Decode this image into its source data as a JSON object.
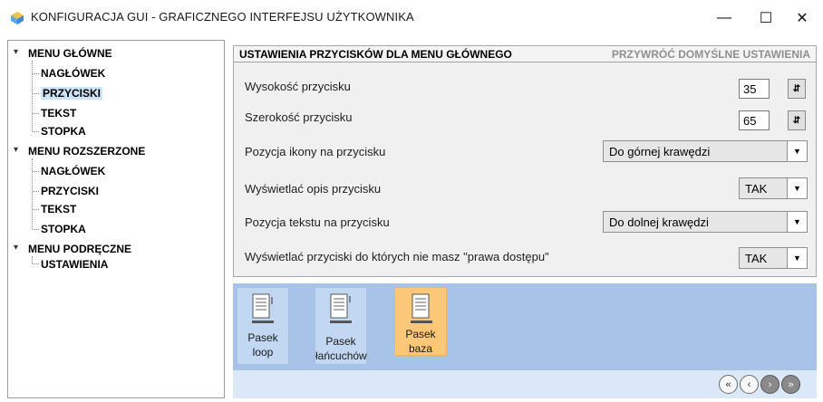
{
  "window": {
    "title": "KONFIGURACJA GUI - GRAFICZNEGO INTERFEJSU UŻYTKOWNIKA",
    "minimize": "—",
    "maximize": "☐",
    "close": "✕"
  },
  "tree": {
    "groups": [
      {
        "label": "MENU GŁÓWNE",
        "children": [
          "NAGŁÓWEK",
          "PRZYCISKI",
          "TEKST",
          "STOPKA"
        ]
      },
      {
        "label": "MENU ROZSZERZONE",
        "children": [
          "NAGŁÓWEK",
          "PRZYCISKI",
          "TEKST",
          "STOPKA"
        ]
      },
      {
        "label": "MENU PODRĘCZNE",
        "children": [
          "USTAWIENIA"
        ]
      }
    ],
    "selected": "MENU GŁÓWNE / PRZYCISKI",
    "expander": "v"
  },
  "settings": {
    "title": "USTAWIENIA PRZYCISKÓW DLA MENU GŁÓWNEGO",
    "reset": "PRZYWRÓĆ DOMYŚLNE USTAWIENIA",
    "rows": [
      {
        "label": "Wysokość przycisku",
        "value": "35",
        "control": "spinner"
      },
      {
        "label": "Szerokość przycisku",
        "value": "65",
        "control": "spinner"
      },
      {
        "label": "Pozycja ikony na przycisku",
        "value": "Do górnej krawędzi",
        "control": "select"
      },
      {
        "label": "Wyświetlać opis przycisku",
        "value": "TAK",
        "control": "select"
      },
      {
        "label": "Pozycja tekstu na przycisku",
        "value": "Do dolnej krawędzi",
        "control": "select"
      },
      {
        "label": "Wyświetlać przyciski do których nie masz \"prawa dostępu\"",
        "value": "TAK",
        "control": "select"
      }
    ]
  },
  "preview": {
    "tiles": [
      {
        "line1": "Pasek",
        "line2": "loop",
        "active": false
      },
      {
        "line1": "Pasek",
        "line2": "łańcuchów",
        "active": false
      },
      {
        "line1": "Pasek",
        "line2": "baza",
        "active": true
      }
    ]
  },
  "nav": {
    "first": "«",
    "prev": "‹",
    "next": "›",
    "last": "»"
  },
  "colors": {
    "accent": "#a7c4e8",
    "active_tile": "#fcc877",
    "selection": "#cce4f7"
  }
}
